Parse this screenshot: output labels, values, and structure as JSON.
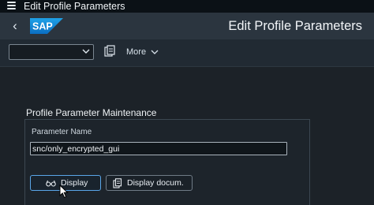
{
  "window": {
    "title": "Edit Profile Parameters"
  },
  "header": {
    "logo_text": "SAP",
    "title": "Edit Profile Parameters"
  },
  "toolbar": {
    "select_value": "",
    "more_label": "More"
  },
  "form": {
    "section_title": "Profile Parameter Maintenance",
    "param_label": "Parameter Name",
    "param_value": "snc/only_encrypted_gui"
  },
  "actions": {
    "display_label": "Display",
    "docum_label": "Display docum."
  },
  "colors": {
    "accent": "#5aa6e8",
    "sap_blue": "#1a7fd1",
    "background": "#1c2228"
  },
  "icons": [
    "menu-icon",
    "back-icon",
    "variant-icon",
    "chevron-down-icon",
    "glasses-icon",
    "document-icon",
    "mouse-cursor-icon"
  ]
}
